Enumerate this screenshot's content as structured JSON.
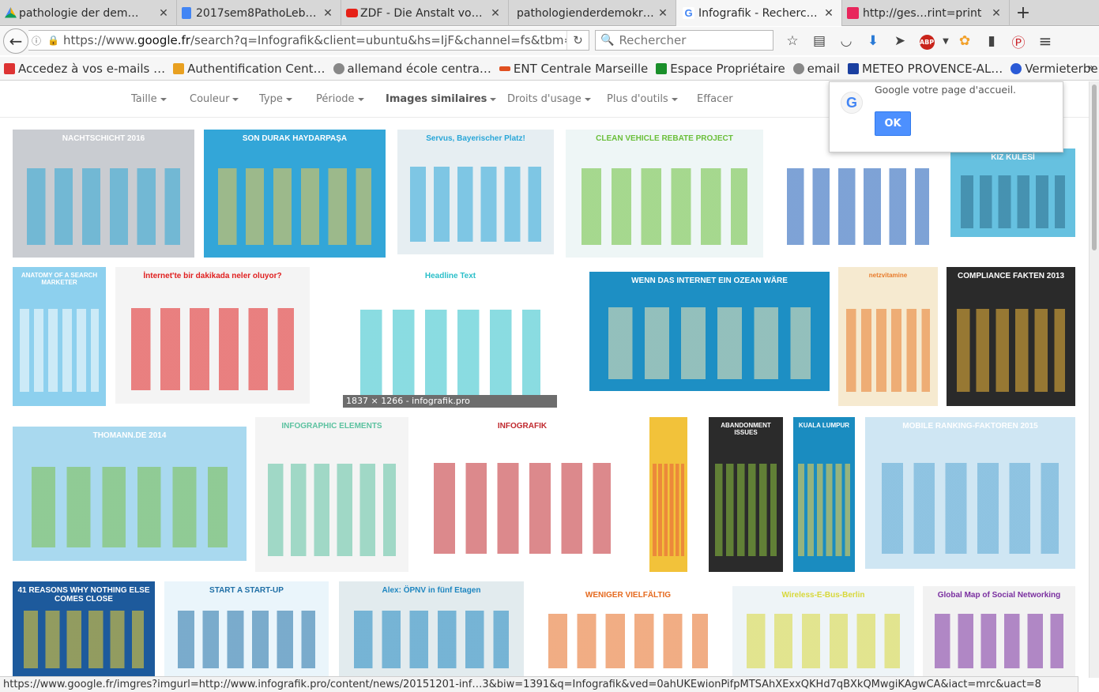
{
  "tabs": [
    {
      "title": "pathologie der dem…",
      "icon": "google-drive-icon",
      "color": "#f4b400"
    },
    {
      "title": "2017sem8PathoLeb…",
      "icon": "google-docs-icon",
      "color": "#4285f4"
    },
    {
      "title": "ZDF - Die Anstalt vo…",
      "icon": "youtube-icon",
      "color": "#e62117"
    },
    {
      "title": "pathologienderdemokr…",
      "icon": "blank-page-icon",
      "color": "#d7d7d7"
    },
    {
      "title": "Infografik - Recherc…",
      "icon": "google-icon",
      "color": "#4285f4"
    },
    {
      "title": "http://ges…rint=print",
      "icon": "gesis-icon",
      "color": "#e8265c"
    }
  ],
  "close_glyph": "✕",
  "new_tab_glyph": "+",
  "navbar": {
    "back_glyph": "←",
    "url_prefix": "https://www.",
    "url_domain": "google.fr",
    "url_rest": "/search?q=Infografik&client=ubuntu&hs=IjF&channel=fs&tbm=isch&",
    "reload_glyph": "↻",
    "search_placeholder": "Rechercher"
  },
  "bookmarks": [
    {
      "label": "Accedez à vos e-mails …",
      "color": "#d33"
    },
    {
      "label": "Authentification Cent…",
      "color": "#e8a020"
    },
    {
      "label": "allemand école centra…",
      "color": "#777"
    },
    {
      "label": "ENT Centrale Marseille",
      "color": "#e05020"
    },
    {
      "label": "Espace Propriétaire",
      "color": "#1a8f2a"
    },
    {
      "label": "email",
      "color": "#777"
    },
    {
      "label": "METEO PROVENCE-AL…",
      "color": "#1a3fa0"
    },
    {
      "label": "Vermieterbereich",
      "color": "#2a5ad6"
    }
  ],
  "bookmarks_more": "»",
  "filters": [
    "Taille",
    "Couleur",
    "Type",
    "Période",
    "Images similaires",
    "Droits d'usage",
    "Plus d'outils",
    "Effacer"
  ],
  "promo": {
    "message": "Google votre page d'accueil.",
    "ok_label": "OK",
    "logo_letter": "G"
  },
  "hover_info": "1837 × 1266 - infografik.pro",
  "status_url": "https://www.google.fr/imgres?imgurl=http://www.infografik.pro/content/news/20151201-inf…3&biw=1391&q=Infografik&ved=0ahUKEwionPifpMTSAhXExxQKHd7qBXkQMwgiKAgwCA&iact=mrc&uact=8",
  "thumbnails": [
    {
      "title": "NACHTSCHICHT 2016",
      "bg": "#c9ccd1",
      "accent": "#2aa7d6"
    },
    {
      "title": "SON DURAK HAYDARPAŞA",
      "bg": "#33a6d8",
      "accent": "#f2c94c"
    },
    {
      "title": "Servus, Bayerischer Platz!",
      "bg": "#e6eef2",
      "accent": "#28a6d8"
    },
    {
      "title": "CLEAN VEHICLE REBATE PROJECT",
      "bg": "#eef6f6",
      "accent": "#6abf3a"
    },
    {
      "title": "ВАЖНО ЗНАТЬ",
      "bg": "#ffffff",
      "accent": "#1557b5"
    },
    {
      "title": "KIZ KULESİ",
      "bg": "#66c1e0",
      "accent": "#2b6b8a"
    },
    {
      "title": "ANATOMY OF A SEARCH MARKETER",
      "bg": "#8dd0ee",
      "accent": "#ffffff"
    },
    {
      "title": "İnternet'te bir dakikada neler oluyor?",
      "bg": "#f4f4f4",
      "accent": "#e02020"
    },
    {
      "title": "Headline Text",
      "bg": "#ffffff",
      "accent": "#2bbfc9"
    },
    {
      "title": "WENN DAS INTERNET EIN OZEAN WÄRE",
      "bg": "#1d8fc4",
      "accent": "#f4e7b5"
    },
    {
      "title": "netzvitamine",
      "bg": "#f6ead0",
      "accent": "#e87b2b"
    },
    {
      "title": "COMPLIANCE FAKTEN 2013",
      "bg": "#2a2a2a",
      "accent": "#f0b83a"
    },
    {
      "title": "THOMANN.DE 2014",
      "bg": "#a9d9ef",
      "accent": "#7bbf4b"
    },
    {
      "title": "INFOGRAPHIC ELEMENTS",
      "bg": "#f4f4f4",
      "accent": "#5cc2a0"
    },
    {
      "title": "INFOGRAFIK",
      "bg": "#ffffff",
      "accent": "#c0282d"
    },
    {
      "title": "",
      "bg": "#f2c23a",
      "accent": "#e85a3b"
    },
    {
      "title": "ABANDONMENT ISSUES",
      "bg": "#2b2b2b",
      "accent": "#8dc63f"
    },
    {
      "title": "KUALA LUMPUR",
      "bg": "#1a8cc0",
      "accent": "#f7d34a"
    },
    {
      "title": "MOBILE RANKING-FAKTOREN 2015",
      "bg": "#cfe6f3",
      "accent": "#5aa7d3"
    },
    {
      "title": "41 REASONS WHY NOTHING ELSE COMES CLOSE",
      "bg": "#1d5a9c",
      "accent": "#f2d12e"
    },
    {
      "title": "START A START-UP",
      "bg": "#eaf5fb",
      "accent": "#1f6fa6"
    },
    {
      "title": "Alex: ÖPNV in fünf Etagen",
      "bg": "#e2ebee",
      "accent": "#1e86c0"
    },
    {
      "title": "WENIGER VIELFÄLTIG",
      "bg": "#ffffff",
      "accent": "#e56a1f"
    },
    {
      "title": "Wireless-E-Bus-Berlin",
      "bg": "#eef4f7",
      "accent": "#d8d83a"
    },
    {
      "title": "Global Map of Social Networking",
      "bg": "#f2f2f2",
      "accent": "#7a2fa0"
    }
  ]
}
